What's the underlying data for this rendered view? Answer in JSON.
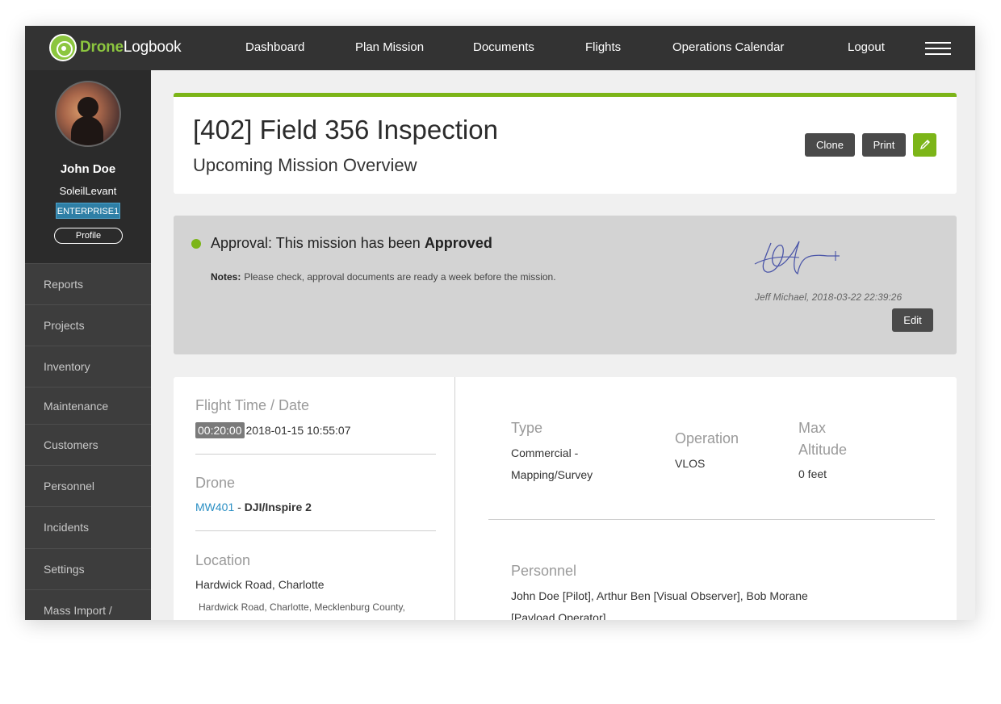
{
  "brand": {
    "part1": "Drone",
    "part2": "Logbook"
  },
  "nav": [
    {
      "label": "Dashboard"
    },
    {
      "label": "Plan Mission"
    },
    {
      "label": "Documents"
    },
    {
      "label": "Flights"
    },
    {
      "label": "Operations Calendar"
    },
    {
      "label": "Logout"
    }
  ],
  "user": {
    "name": "John Doe",
    "handle": "SoleilLevant",
    "plan": "ENTERPRISE1",
    "profile_label": "Profile"
  },
  "sidebar": [
    {
      "label": "Reports"
    },
    {
      "label": "Projects"
    },
    {
      "label": "Inventory"
    },
    {
      "label": "Maintenance"
    },
    {
      "label": "Customers"
    },
    {
      "label": "Personnel"
    },
    {
      "label": "Incidents"
    },
    {
      "label": "Settings"
    },
    {
      "label": "Mass Import /"
    }
  ],
  "mission": {
    "title": "[402] Field 356 Inspection",
    "subtitle": "Upcoming Mission Overview",
    "clone_label": "Clone",
    "print_label": "Print"
  },
  "approval": {
    "prefix": "Approval: This mission has been ",
    "status": "Approved",
    "notes_label": "Notes:",
    "notes": "Please check, approval documents are ready a week before the mission.",
    "signer": "Jeff Michael, 2018-03-22 22:39:26",
    "edit_label": "Edit",
    "status_color": "#7cb518"
  },
  "details": {
    "flight_time_label": "Flight Time / Date",
    "duration": "00:20:00",
    "datetime": "2018-01-15 10:55:07",
    "drone_label": "Drone",
    "drone_id": "MW401",
    "drone_sep": " - ",
    "drone_model": "DJI/Inspire 2",
    "location_label": "Location",
    "location": "Hardwick Road, Charlotte",
    "location_full": "Hardwick Road, Charlotte, Mecklenburg County,",
    "type_label": "Type",
    "type_line1": "Commercial -",
    "type_line2": "Mapping/Survey",
    "operation_label": "Operation",
    "operation": "VLOS",
    "altitude_label_1": "Max",
    "altitude_label_2": "Altitude",
    "altitude": "0 feet",
    "personnel_label": "Personnel",
    "personnel_line1": "John Doe [Pilot], Arthur Ben [Visual Observer], Bob Morane",
    "personnel_line2": "[Payload Operator]"
  },
  "colors": {
    "accent": "#7cb518",
    "link": "#2a8fc4",
    "nav_bg": "#333333"
  }
}
